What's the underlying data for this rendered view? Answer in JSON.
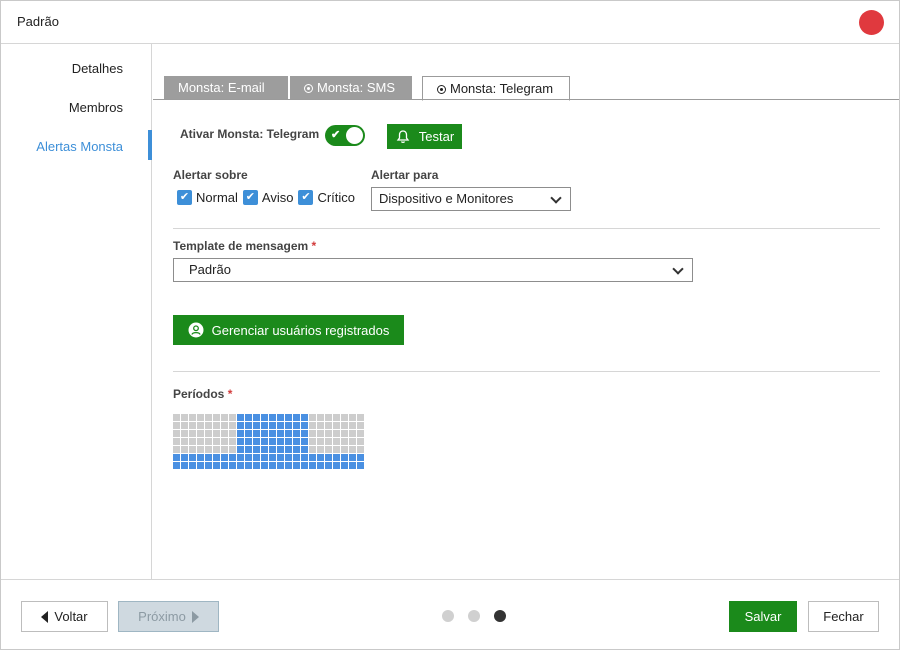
{
  "window": {
    "title": "Padrão",
    "close_color": "#e0393e"
  },
  "sidebar": {
    "items": [
      {
        "label": "Detalhes"
      },
      {
        "label": "Membros"
      },
      {
        "label": "Alertas Monsta",
        "active": true
      }
    ]
  },
  "tabs": [
    {
      "label": "Monsta: E-mail",
      "radio": false,
      "active": false
    },
    {
      "label": "Monsta: SMS",
      "radio": true,
      "active": false
    },
    {
      "label": "Monsta: Telegram",
      "radio": true,
      "active": true
    }
  ],
  "telegram": {
    "enable_label": "Ativar Monsta: Telegram",
    "enabled": true,
    "test_button": "Testar",
    "alert_about_label": "Alertar sobre",
    "checkboxes": [
      {
        "label": "Normal",
        "checked": true
      },
      {
        "label": "Aviso",
        "checked": true
      },
      {
        "label": "Crítico",
        "checked": true
      }
    ],
    "alert_to_label": "Alertar para",
    "alert_to_value": "Dispositivo e Monitores",
    "template_label": "Template de mensagem",
    "required_mark": "*",
    "template_value": "Padrão",
    "manage_users_button": "Gerenciar usuários registrados",
    "periods_label": "Períodos",
    "periods_grid": {
      "rows": 7,
      "cols": 24,
      "active_rows_0_4_hours": [
        8,
        9,
        10,
        11,
        12,
        13,
        14,
        15,
        16
      ],
      "active_full_rows": [
        5,
        6
      ]
    }
  },
  "footer": {
    "back_button": "Voltar",
    "next_button": "Próximo",
    "save_button": "Salvar",
    "close_button": "Fechar",
    "steps": 3,
    "current_step": 3
  },
  "colors": {
    "accent_green": "#1b8a1b",
    "accent_blue": "#3d8fd8",
    "tab_inactive": "#9d9d9d"
  }
}
